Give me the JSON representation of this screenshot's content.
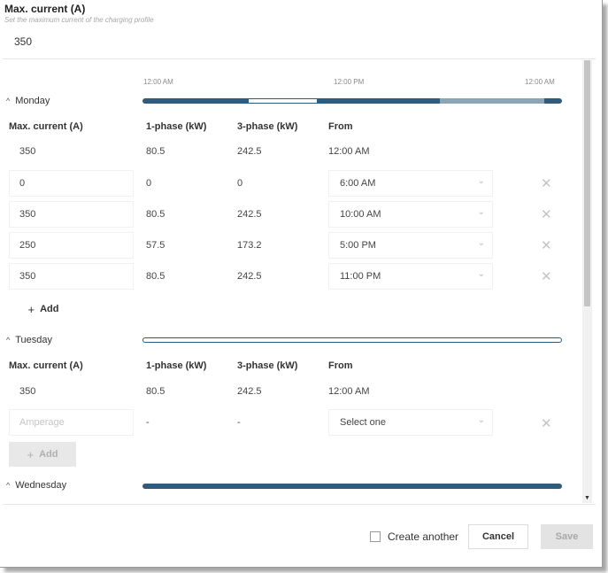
{
  "header": {
    "label": "Max. current (A)",
    "help": "Set the maximum current of the charging profile",
    "value": "350"
  },
  "timeline_ticks": [
    "12:00 AM",
    "12:00 PM",
    "12:00 AM"
  ],
  "columns": {
    "max_current": "Max. current (A)",
    "one_phase": "1-phase (kW)",
    "three_phase": "3-phase (kW)",
    "from": "From"
  },
  "days": {
    "monday": {
      "name": "Monday",
      "rows": [
        {
          "current": "350",
          "one_phase": "80.5",
          "three_phase": "242.5",
          "from": "12:00 AM"
        },
        {
          "current": "0",
          "one_phase": "0",
          "three_phase": "0",
          "from": "6:00 AM"
        },
        {
          "current": "350",
          "one_phase": "80.5",
          "three_phase": "242.5",
          "from": "10:00 AM"
        },
        {
          "current": "250",
          "one_phase": "57.5",
          "three_phase": "173.2",
          "from": "5:00 PM"
        },
        {
          "current": "350",
          "one_phase": "80.5",
          "three_phase": "242.5",
          "from": "11:00 PM"
        }
      ],
      "add_label": "Add"
    },
    "tuesday": {
      "name": "Tuesday",
      "rows": [
        {
          "current": "350",
          "one_phase": "80.5",
          "three_phase": "242.5",
          "from": "12:00 AM"
        }
      ],
      "new_row": {
        "current_placeholder": "Amperage",
        "one_phase": "-",
        "three_phase": "-",
        "from_placeholder": "Select one"
      },
      "add_label": "Add"
    },
    "wednesday": {
      "name": "Wednesday"
    }
  },
  "footer": {
    "create_another": "Create another",
    "cancel": "Cancel",
    "save": "Save"
  },
  "colors": {
    "accent": "#2f5b7d",
    "accent_light": "#8aa4b8"
  }
}
